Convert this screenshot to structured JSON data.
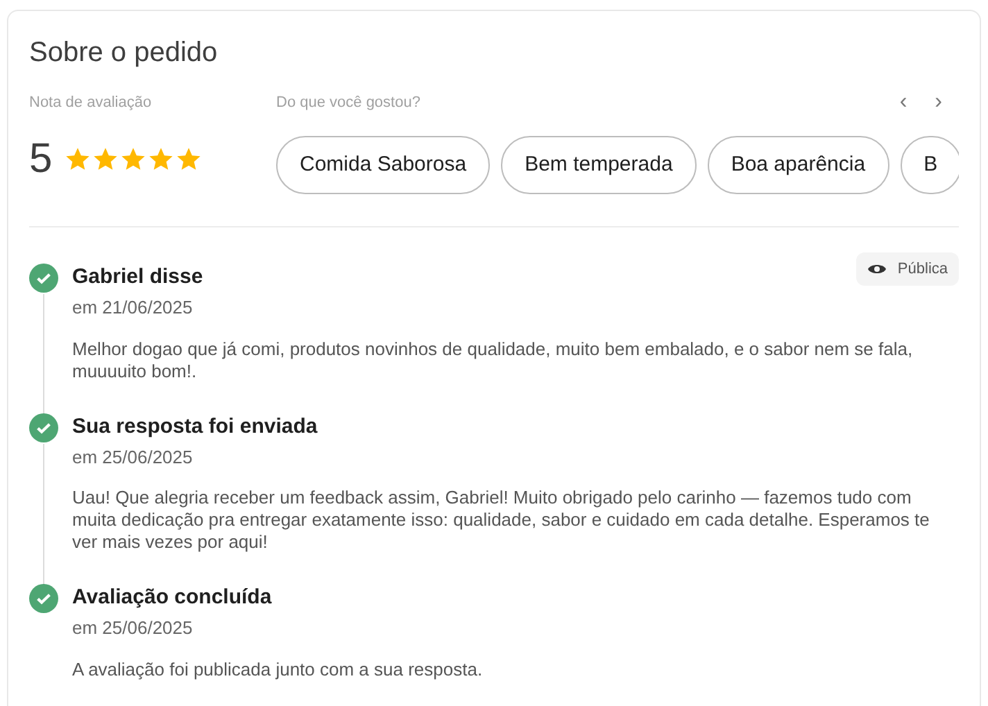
{
  "title": "Sobre o pedido",
  "rating": {
    "label": "Nota de avaliação",
    "value": "5",
    "stars": 5
  },
  "liked": {
    "label": "Do que você gostou?",
    "prev": "‹",
    "next": "›",
    "chips": [
      "Comida Saborosa",
      "Bem temperada",
      "Boa aparência",
      "B"
    ]
  },
  "timeline": [
    {
      "title": "Gabriel disse",
      "date": "em 21/06/2025",
      "text": "Melhor dogao que já comi, produtos novinhos de qualidade, muito bem embalado, e o sabor nem se fala, muuuuito bom!.",
      "badge": "Pública",
      "done": true
    },
    {
      "title": "Sua resposta foi enviada",
      "date": "em 25/06/2025",
      "text": "Uau! Que alegria receber um feedback assim, Gabriel! Muito obrigado pelo carinho — fazemos tudo com muita dedicação pra entregar exatamente isso: qualidade, sabor e cuidado em cada detalhe. Esperamos te ver mais vezes por aqui!",
      "done": true
    },
    {
      "title": "Avaliação concluída",
      "date": "em 25/06/2025",
      "text": "A avaliação foi publicada junto com a sua resposta.",
      "done": true
    }
  ]
}
